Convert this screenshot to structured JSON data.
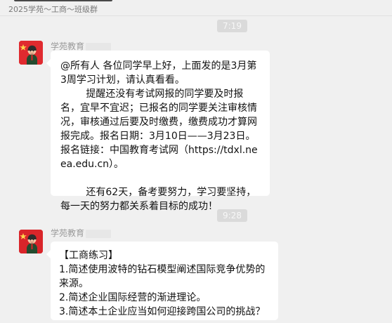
{
  "header": {
    "subtitle": "2025学苑～工商～班级群"
  },
  "messages": [
    {
      "time": "7:19",
      "sender": "学苑教育",
      "lines": [
        "@所有人 各位同学早上好，上面发的是3月第3周学习计划，请认真看看。",
        "提醒还没有考试网报的同学要及时报名，宜早不宜迟；已报名的同学要关注审核情况，审核通过后要及时缴费，缴费成功才算网报完成。报名日期：3月10日——3月23日。报名链接：中国教育考试网（https://tdxl.neea.edu.cn）。",
        "",
        "还有62天，备考要努力，学习要坚持，每一天的努力都关系着目标的成功！"
      ]
    },
    {
      "time": "9:28",
      "sender": "学苑教育",
      "lines": [
        "【工商练习】",
        "1.简述使用波特的钻石模型阐述国际竞争优势的来源。",
        "2.简述企业国际经营的渐进理论。",
        "3.简述本土企业应当如何迎接跨国公司的挑战？"
      ]
    }
  ],
  "colors": {
    "background": "#f0f0f0",
    "bubble": "#ffffff",
    "time_pill": "#dadada",
    "avatar": "#d9252a"
  },
  "icons": {
    "avatar": "red-flag-person-avatar"
  }
}
